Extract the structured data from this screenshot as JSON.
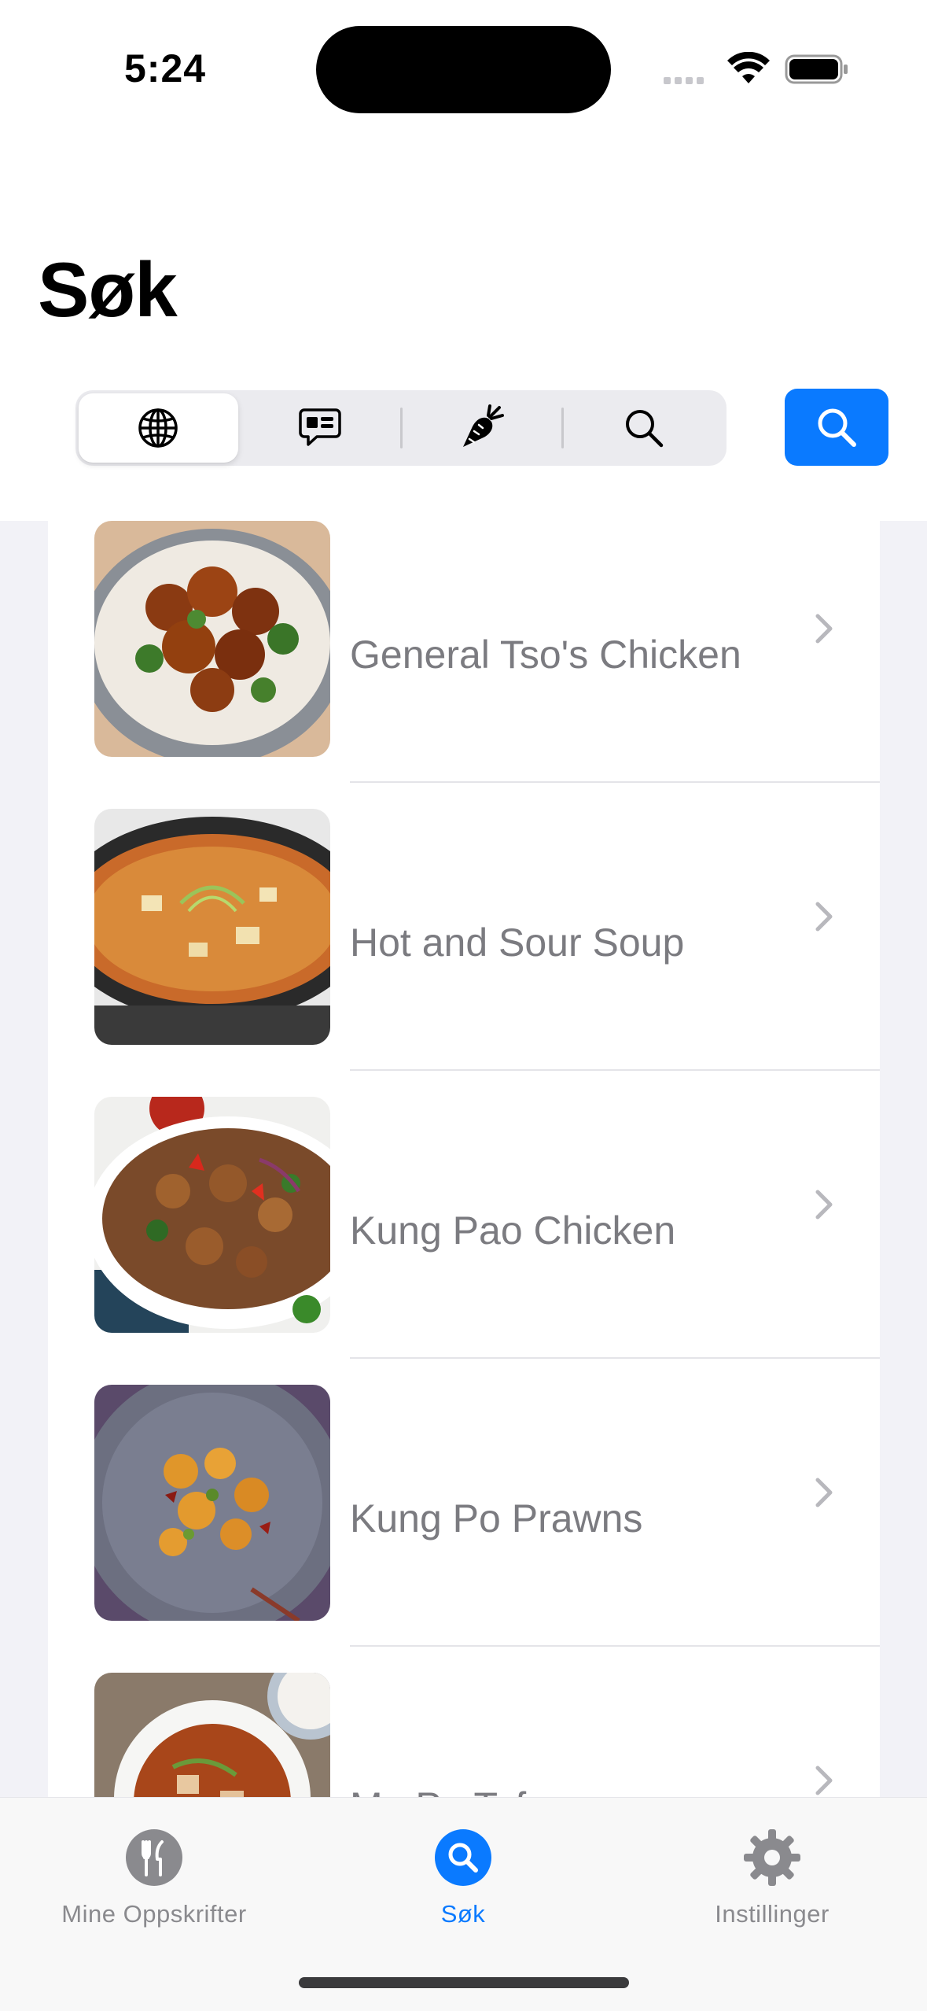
{
  "status_bar": {
    "time": "5:24"
  },
  "header": {
    "title": "Søk"
  },
  "segments": [
    {
      "icon": "globe-icon",
      "selected": true
    },
    {
      "icon": "chat-bubble-icon",
      "selected": false
    },
    {
      "icon": "carrot-icon",
      "selected": false
    },
    {
      "icon": "magnifier-icon",
      "selected": false
    }
  ],
  "search_button": {
    "icon": "search-icon"
  },
  "recipes": [
    {
      "name": "General Tso's Chicken"
    },
    {
      "name": "Hot and Sour Soup"
    },
    {
      "name": "Kung Pao Chicken"
    },
    {
      "name": "Kung Po Prawns"
    },
    {
      "name": "Ma Po Tofu"
    }
  ],
  "tab_bar": {
    "items": [
      {
        "label": "Mine Oppskrifter",
        "icon": "fork-knife-icon",
        "active": false
      },
      {
        "label": "Søk",
        "icon": "search-icon",
        "active": true
      },
      {
        "label": "Instillinger",
        "icon": "gear-icon",
        "active": false
      }
    ]
  },
  "colors": {
    "accent": "#0a7aff",
    "inactive": "#8a8a8e"
  }
}
